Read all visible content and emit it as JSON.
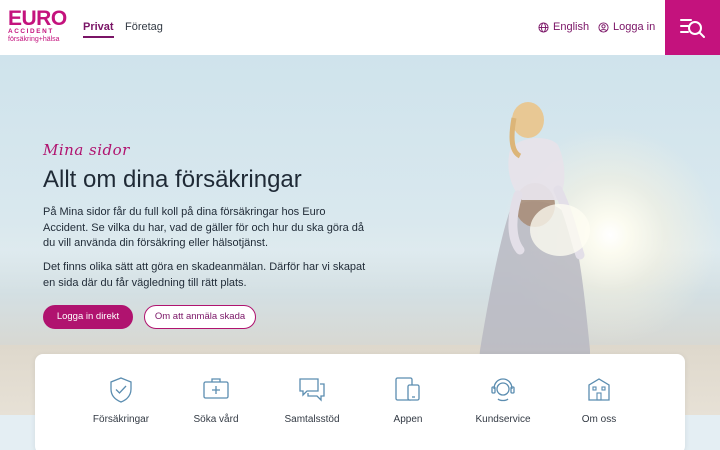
{
  "brand": {
    "name": "EURO",
    "sub": "ACCIDENT",
    "tagline": "försäkring+hälsa",
    "color": "#c4127d"
  },
  "nav": {
    "items": [
      {
        "label": "Privat",
        "active": true
      },
      {
        "label": "Företag",
        "active": false
      }
    ]
  },
  "top_links": {
    "language": {
      "label": "English",
      "icon": "globe-icon"
    },
    "login": {
      "label": "Logga in",
      "icon": "user-icon"
    },
    "menu": {
      "icon": "menu-search-icon"
    }
  },
  "hero": {
    "kicker": "Mina sidor",
    "title": "Allt om dina försäkringar",
    "paragraph1": "På Mina sidor får du full koll på dina försäkringar hos Euro Accident. Se vilka du har, vad de gäller för och hur du ska göra då du vill använda din försäkring eller hälsotjänst.",
    "paragraph2": "Det finns olika sätt att göra en skadeanmälan. Därför har vi skapat en sida där du får vägledning till rätt plats.",
    "primary_button": "Logga in direkt",
    "secondary_button": "Om att anmäla skada"
  },
  "quick_links": [
    {
      "label": "Försäkringar",
      "icon": "shield-check-icon"
    },
    {
      "label": "Söka vård",
      "icon": "medical-kit-icon"
    },
    {
      "label": "Samtalsstöd",
      "icon": "chat-bubbles-icon"
    },
    {
      "label": "Appen",
      "icon": "devices-icon"
    },
    {
      "label": "Kundservice",
      "icon": "headset-icon"
    },
    {
      "label": "Om oss",
      "icon": "building-icon"
    }
  ],
  "colors": {
    "accent": "#b0136f",
    "accent_dark": "#7a1466",
    "icon_blue": "#5b8db0"
  }
}
